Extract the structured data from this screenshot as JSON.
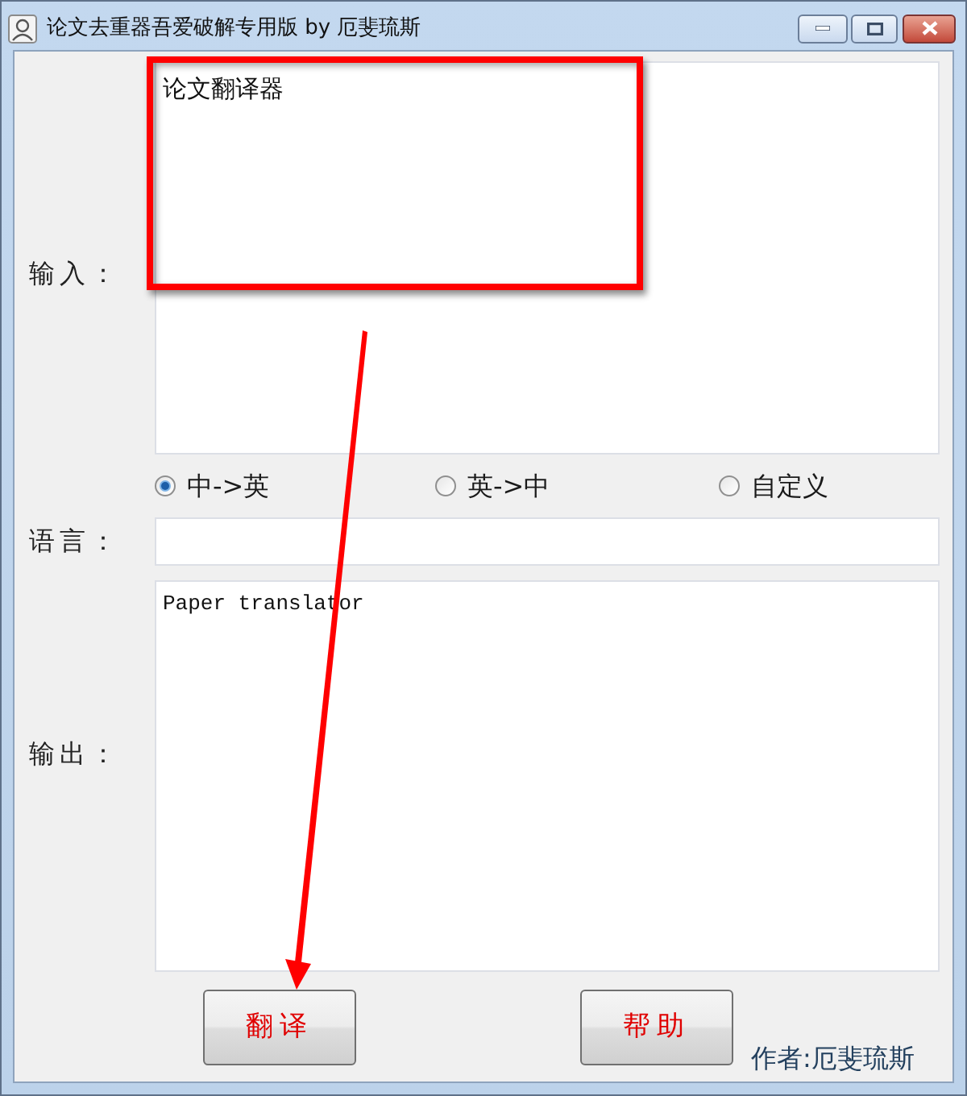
{
  "window": {
    "title": "论文去重器吾爱破解专用版 by 厄斐琉斯"
  },
  "input": {
    "label": "输入：",
    "value": "论文翻译器"
  },
  "languages": [
    {
      "label": "中->英",
      "selected": true
    },
    {
      "label": "英->中",
      "selected": false
    },
    {
      "label": "自定义",
      "selected": false
    }
  ],
  "language_field": {
    "label": "语言："
  },
  "output": {
    "label": "输出：",
    "value": "Paper translator"
  },
  "buttons": [
    {
      "label": "翻译"
    },
    {
      "label": "帮助"
    }
  ],
  "author": "作者:厄斐琉斯"
}
